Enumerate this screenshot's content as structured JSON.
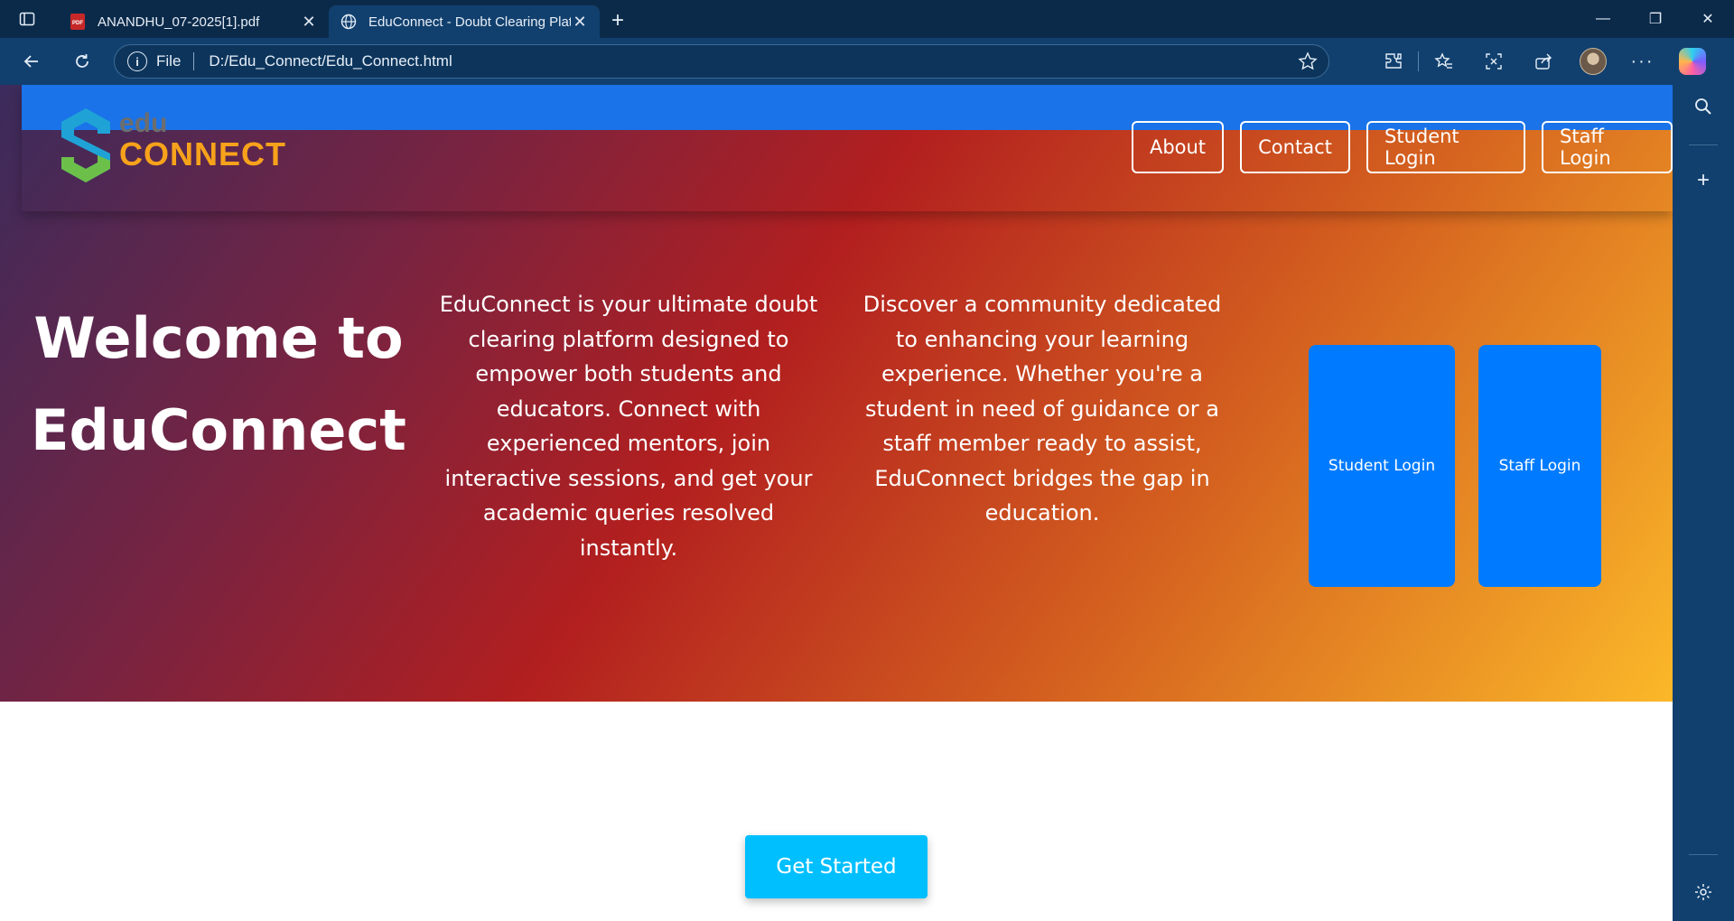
{
  "browser": {
    "tabs": [
      {
        "title": "ANANDHU_07-2025[1].pdf",
        "favicon": "pdf-icon",
        "active": false
      },
      {
        "title": "EduConnect - Doubt Clearing Plat",
        "favicon": "globe-icon",
        "active": true
      }
    ],
    "address": {
      "scheme": "File",
      "url": "D:/Edu_Connect/Edu_Connect.html"
    },
    "accent": "#11406e"
  },
  "site": {
    "logo": {
      "edu": "edu",
      "connect": "CONNECT"
    },
    "nav": {
      "about": "About",
      "contact": "Contact",
      "student_login": "Student Login",
      "staff_login": "Staff Login"
    },
    "hero": {
      "heading_line1": "Welcome to",
      "heading_line2": "EduConnect",
      "paragraph1": "EduConnect is your ultimate doubt clearing platform designed to empower both students and educators. Connect with experienced mentors, join interactive sessions, and get your academic queries resolved instantly.",
      "paragraph2": "Discover a community dedicated to enhancing your learning experience. Whether you're a student in need of guidance or a staff member ready to assist, EduConnect bridges the gap in education."
    },
    "cards": {
      "student": "Student Login",
      "staff": "Staff Login"
    },
    "cta": "Get Started",
    "colors": {
      "card_blue": "#007bff",
      "cta_blue": "#00bfff",
      "logo_orange": "#f7a21b"
    }
  }
}
